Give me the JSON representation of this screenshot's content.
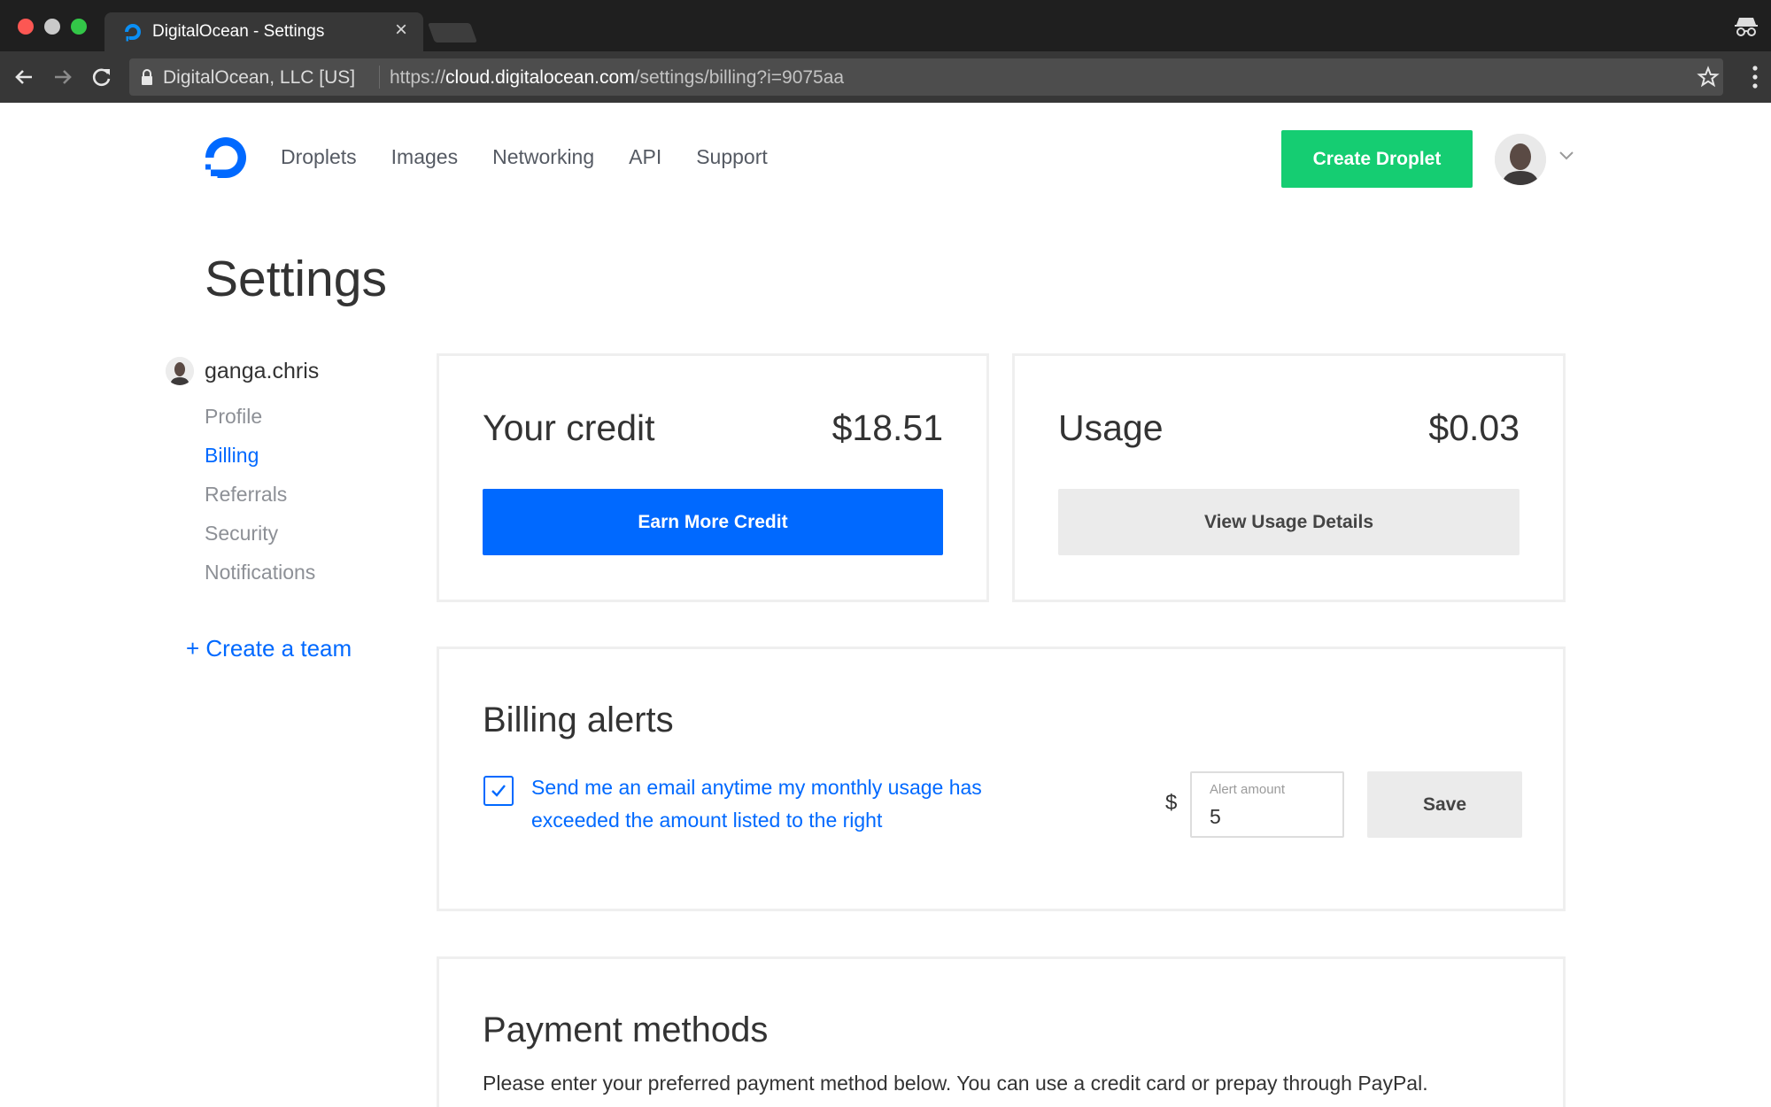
{
  "browser": {
    "tab_title": "DigitalOcean - Settings",
    "tab_close": "×",
    "site_identity": "DigitalOcean, LLC [US]",
    "url_scheme": "https://",
    "url_host": "cloud.digitalocean.com",
    "url_path": "/settings/billing?i=9075aa"
  },
  "header": {
    "nav": [
      "Droplets",
      "Images",
      "Networking",
      "API",
      "Support"
    ],
    "create_droplet_label": "Create Droplet"
  },
  "page": {
    "title": "Settings"
  },
  "sidebar": {
    "username": "ganga.chris",
    "items": [
      {
        "label": "Profile",
        "active": false
      },
      {
        "label": "Billing",
        "active": true
      },
      {
        "label": "Referrals",
        "active": false
      },
      {
        "label": "Security",
        "active": false
      },
      {
        "label": "Notifications",
        "active": false
      }
    ],
    "create_team_label": "+ Create a team"
  },
  "credit": {
    "label": "Your credit",
    "amount": "$18.51",
    "button_label": "Earn More Credit"
  },
  "usage": {
    "label": "Usage",
    "amount": "$0.03",
    "button_label": "View Usage Details"
  },
  "billing_alerts": {
    "title": "Billing alerts",
    "checkbox_checked": true,
    "checkbox_text": "Send me an email anytime my monthly usage has exceeded the amount listed to the right",
    "currency_symbol": "$",
    "amount_label": "Alert amount",
    "amount_value": "5",
    "save_label": "Save"
  },
  "payment_methods": {
    "title": "Payment methods",
    "description": "Please enter your preferred payment method below. You can use a credit card or prepay through PayPal."
  },
  "colors": {
    "brand_blue": "#0069ff",
    "create_green": "#15cd72",
    "chrome_dark": "#1f1f1f"
  }
}
